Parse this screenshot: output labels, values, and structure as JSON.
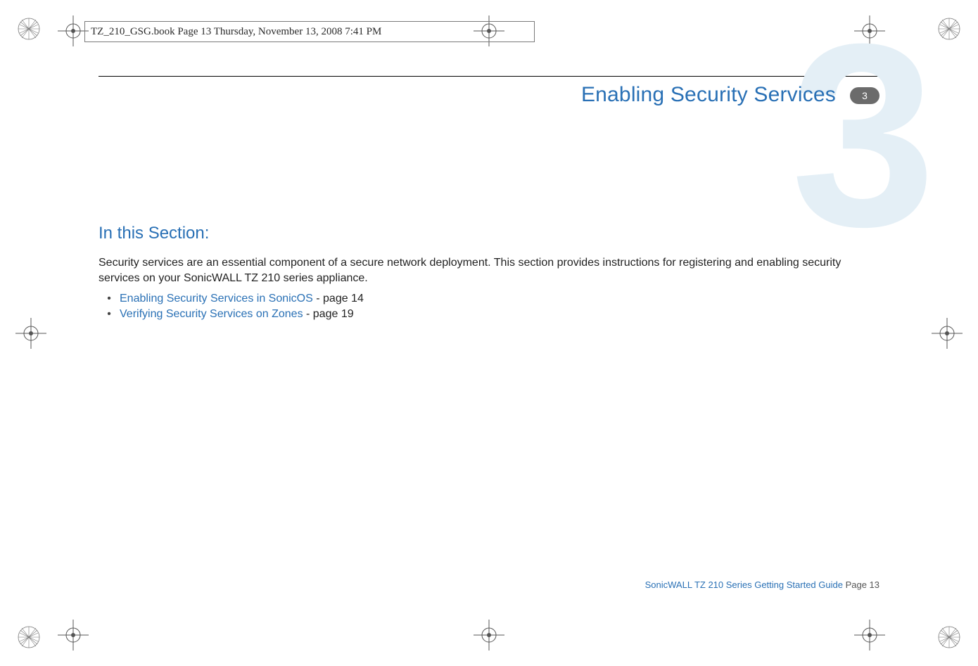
{
  "header_tag": "TZ_210_GSG.book  Page 13  Thursday, November 13, 2008  7:41 PM",
  "chapter": {
    "big_number": "3",
    "title": "Enabling Security Services",
    "badge": "3"
  },
  "section_heading": "In this Section:",
  "intro": "Security services are an essential component of a secure network deployment. This section provides instructions for registering and enabling security services on your SonicWALL TZ 210 series appliance.",
  "bullets": [
    {
      "link": "Enabling Security Services in SonicOS",
      "suffix": " - page 14"
    },
    {
      "link": "Verifying Security Services on Zones",
      "suffix": " - page 19"
    }
  ],
  "footer": {
    "guide": "SonicWALL TZ 210 Series Getting Started Guide",
    "page": "  Page 13"
  }
}
